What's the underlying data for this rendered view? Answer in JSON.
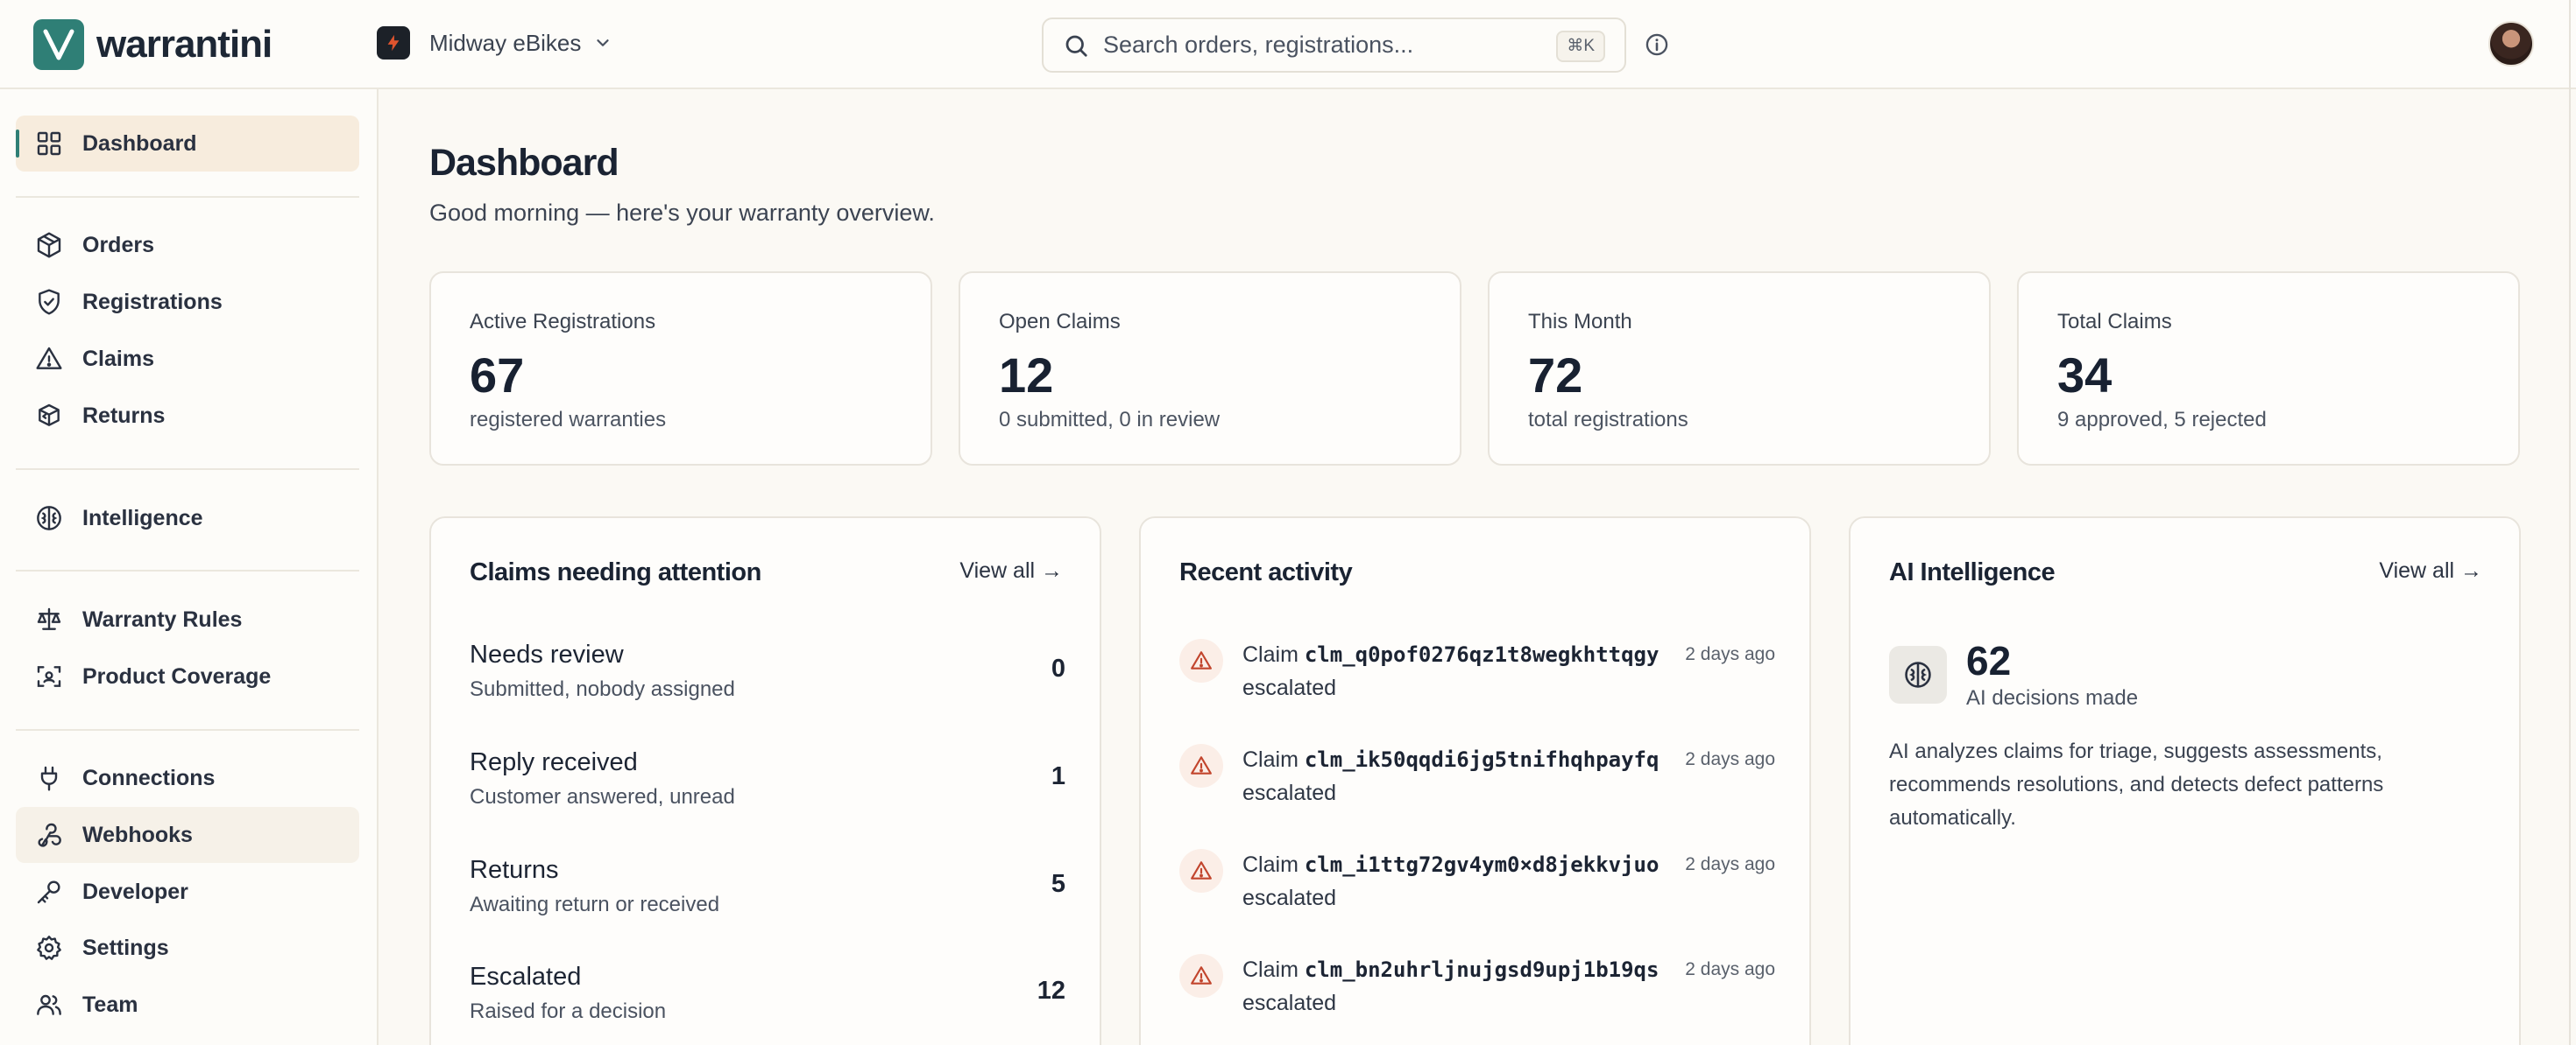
{
  "app": {
    "name": "warrantini",
    "brand_color": "#2f7f76"
  },
  "org": {
    "name": "Midway eBikes"
  },
  "search": {
    "placeholder": "Search orders, registrations...",
    "shortcut": "⌘K"
  },
  "sidebar": {
    "items": [
      {
        "label": "Dashboard",
        "icon": "grid-icon"
      },
      {
        "label": "Orders",
        "icon": "box-icon"
      },
      {
        "label": "Registrations",
        "icon": "shield-check-icon"
      },
      {
        "label": "Claims",
        "icon": "warning-icon"
      },
      {
        "label": "Returns",
        "icon": "package-return-icon"
      },
      {
        "label": "Intelligence",
        "icon": "brain-icon"
      },
      {
        "label": "Warranty Rules",
        "icon": "scale-icon"
      },
      {
        "label": "Product Coverage",
        "icon": "scan-icon"
      },
      {
        "label": "Connections",
        "icon": "plug-icon"
      },
      {
        "label": "Webhooks",
        "icon": "webhook-icon"
      },
      {
        "label": "Developer",
        "icon": "key-icon"
      },
      {
        "label": "Settings",
        "icon": "gear-icon"
      },
      {
        "label": "Team",
        "icon": "users-icon"
      }
    ]
  },
  "page": {
    "title": "Dashboard",
    "subtitle": "Good morning — here's your warranty overview."
  },
  "stats": [
    {
      "label": "Active Registrations",
      "value": "67",
      "caption": "registered warranties"
    },
    {
      "label": "Open Claims",
      "value": "12",
      "caption": "0 submitted, 0 in review"
    },
    {
      "label": "This Month",
      "value": "72",
      "caption": "total registrations"
    },
    {
      "label": "Total Claims",
      "value": "34",
      "caption": "9 approved, 5 rejected"
    }
  ],
  "attention": {
    "title": "Claims needing attention",
    "view_all": "View all →",
    "rows": [
      {
        "title": "Needs review",
        "sub": "Submitted, nobody assigned",
        "count": "0"
      },
      {
        "title": "Reply received",
        "sub": "Customer answered, unread",
        "count": "1"
      },
      {
        "title": "Returns",
        "sub": "Awaiting return or received",
        "count": "5"
      },
      {
        "title": "Escalated",
        "sub": "Raised for a decision",
        "count": "12"
      }
    ]
  },
  "activity": {
    "title": "Recent activity",
    "claim_word": "Claim",
    "rows": [
      {
        "id": "clm_q0pof0276qz1t8wegkhttqgy",
        "status": "escalated",
        "time": "2 days ago"
      },
      {
        "id": "clm_ik50qqdi6jg5tnifhqhpayfq",
        "status": "escalated",
        "time": "2 days ago"
      },
      {
        "id": "clm_i1ttg72gv4ym0×d8jekkvjuo",
        "status": "escalated",
        "time": "2 days ago"
      },
      {
        "id": "clm_bn2uhrljnujgsd9upj1b19qs",
        "status": "escalated",
        "time": "2 days ago"
      }
    ]
  },
  "ai": {
    "title": "AI Intelligence",
    "view_all": "View all →",
    "value": "62",
    "caption": "AI decisions made",
    "description": "AI analyzes claims for triage, suggests assessments, recommends resolutions, and detects defect patterns automatically."
  }
}
